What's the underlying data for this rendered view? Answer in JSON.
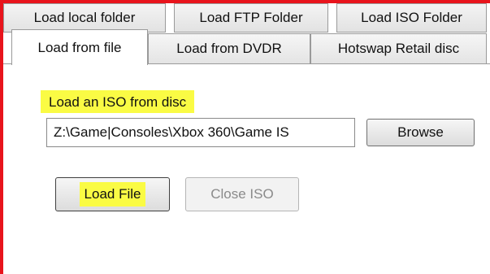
{
  "tabs_row_back": [
    {
      "label": "Load local folder"
    },
    {
      "label": "Load FTP Folder"
    },
    {
      "label": "Load ISO Folder"
    }
  ],
  "tabs_row_front": [
    {
      "label": "Load from file",
      "selected": true
    },
    {
      "label": "Load from DVDR"
    },
    {
      "label": "Hotswap Retail disc"
    }
  ],
  "load_file_panel": {
    "section_label": "Load an ISO from disc",
    "path_value": "Z:\\Game|Consoles\\Xbox 360\\Game IS",
    "browse_label": "Browse",
    "load_file_label": "Load File",
    "close_iso_label": "Close ISO",
    "close_iso_enabled": false
  },
  "colors": {
    "highlight": "#fafb44",
    "frame": "#e8141c"
  }
}
